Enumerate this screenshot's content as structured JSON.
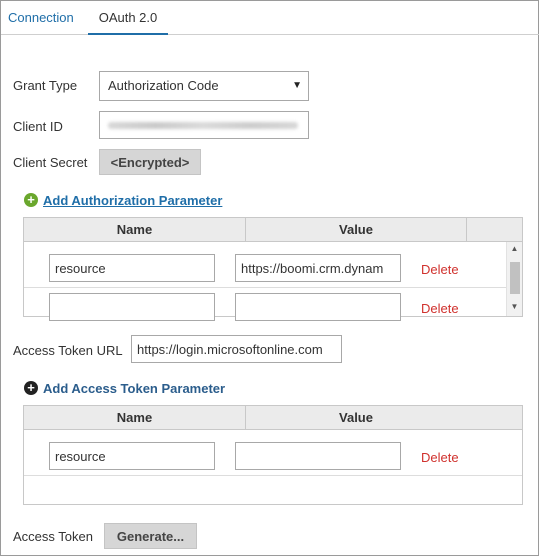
{
  "tabs": [
    {
      "label": "Connection"
    },
    {
      "label": "OAuth 2.0"
    }
  ],
  "grant_type": {
    "label": "Grant Type",
    "selected": "Authorization Code"
  },
  "client_id": {
    "label": "Client ID"
  },
  "client_secret": {
    "label": "Client Secret",
    "button_label": "<Encrypted>"
  },
  "auth_params": {
    "add_label": "Add Authorization Parameter",
    "columns": {
      "name": "Name",
      "value": "Value"
    },
    "rows": [
      {
        "name": "resource",
        "value": "https://boomi.crm.dynam",
        "delete_label": "Delete"
      },
      {
        "name": "",
        "value": "",
        "delete_label": "Delete"
      }
    ]
  },
  "access_token_url": {
    "label": "Access Token URL",
    "value": "https://login.microsoftonline.com"
  },
  "token_params": {
    "add_label": "Add Access Token Parameter",
    "columns": {
      "name": "Name",
      "value": "Value"
    },
    "rows": [
      {
        "name": "resource",
        "value": "",
        "delete_label": "Delete"
      }
    ]
  },
  "access_token": {
    "label": "Access Token",
    "button_label": "Generate..."
  },
  "colors": {
    "link": "#1f6ea8",
    "delete": "#d0312d",
    "add_auth_icon": "#6aa72d",
    "add_token_icon": "#222222",
    "button_bg": "#d6d6d6",
    "header_bg": "#ebebeb"
  },
  "icons": {
    "dropdown": "chevron-down-icon",
    "add_auth": "plus-circle-icon",
    "add_token": "plus-circle-icon",
    "scroll_up": "arrow-up-icon",
    "scroll_down": "arrow-down-icon"
  }
}
